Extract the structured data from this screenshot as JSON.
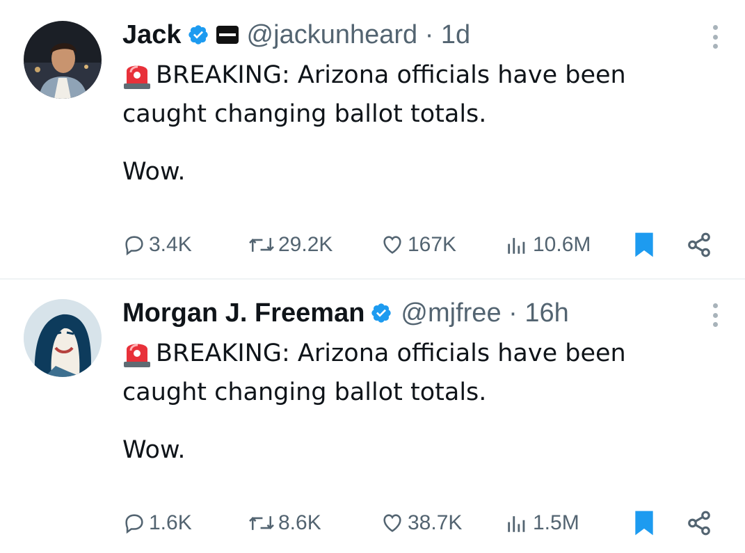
{
  "tweets": [
    {
      "name": "Jack",
      "handle": "@jackunheard",
      "time": "1d",
      "handle_time": "@jackunheard · 1d",
      "verified": true,
      "affiliation_icon": "conservative-badge-icon",
      "text_line1": "BREAKING: Arizona officials have been",
      "text_line2": "caught changing ballot totals.",
      "text_line3": "Wow.",
      "stats": {
        "replies": "3.4K",
        "reposts": "29.2K",
        "likes": "167K",
        "views": "10.6M"
      }
    },
    {
      "name": "Morgan J. Freeman",
      "handle": "@mjfree",
      "time": "16h",
      "handle_time": "@mjfree · 16h",
      "verified": true,
      "text_line1": "BREAKING: Arizona officials have been",
      "text_line2": "caught changing ballot totals.",
      "text_line3": "Wow.",
      "stats": {
        "replies": "1.6K",
        "reposts": "8.6K",
        "likes": "38.7K",
        "views": "1.5M"
      }
    }
  ],
  "colors": {
    "accent": "#1d9bf0",
    "muted": "#536471",
    "text": "#0f1419",
    "divider": "#eff3f4"
  }
}
